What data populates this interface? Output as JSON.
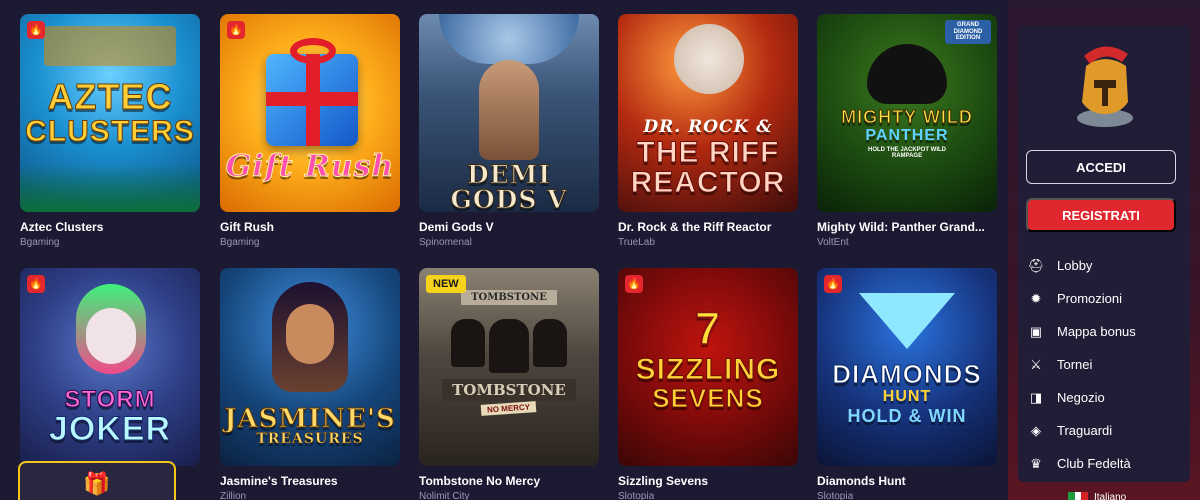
{
  "games": [
    {
      "title": "Aztec Clusters",
      "provider": "Bgaming",
      "badge": "hot",
      "art": {
        "line1": "AZTEC",
        "line2": "CLUSTERS"
      }
    },
    {
      "title": "Gift Rush",
      "provider": "Bgaming",
      "badge": "hot",
      "art": {
        "line1": "Gift Rush"
      }
    },
    {
      "title": "Demi Gods V",
      "provider": "Spinomenal",
      "badge": "",
      "art": {
        "line1": "DEMI GODS V"
      }
    },
    {
      "title": "Dr. Rock & the Riff Reactor",
      "provider": "TrueLab",
      "badge": "",
      "art": {
        "line1": "DR. ROCK &",
        "line2": "THE RIFF",
        "line3": "REACTOR"
      }
    },
    {
      "title": "Mighty Wild: Panther Grand...",
      "provider": "VoltEnt",
      "badge": "",
      "art": {
        "line1": "MIGHTY WILD",
        "line2": "PANTHER",
        "line3": "HOLD THE JACKPOT WILD RAMPAGE",
        "corner": "GRAND DIAMOND EDITION"
      }
    },
    {
      "title": "",
      "provider": "",
      "badge": "hot",
      "art": {
        "line1": "STORM",
        "line2": "JOKER"
      }
    },
    {
      "title": "Jasmine's Treasures",
      "provider": "Zillion",
      "badge": "",
      "art": {
        "line1": "JASMINE'S",
        "line2": "TREASURES"
      }
    },
    {
      "title": "Tombstone No Mercy",
      "provider": "Nolimit City",
      "badge": "new",
      "art": {
        "line1": "TOMBSTONE",
        "line2": "TOMBSTONE",
        "line3": "NO MERCY"
      }
    },
    {
      "title": "Sizzling Sevens",
      "provider": "Slotopia",
      "badge": "hot",
      "art": {
        "line1": "7",
        "line2": "SIZZLING",
        "line3": "SEVENS"
      }
    },
    {
      "title": "Diamonds Hunt",
      "provider": "Slotopia",
      "badge": "hot",
      "art": {
        "line1": "DIAMONDS",
        "line2": "HUNT",
        "line3": "HOLD & WIN"
      }
    }
  ],
  "badges": {
    "new_label": "NEW"
  },
  "sidebar": {
    "login_label": "ACCEDI",
    "register_label": "REGISTRATI",
    "menu": [
      {
        "label": "Lobby",
        "icon": "helmet-icon",
        "glyph": "⛑"
      },
      {
        "label": "Promozioni",
        "icon": "promo-icon",
        "glyph": "✹"
      },
      {
        "label": "Mappa bonus",
        "icon": "chest-icon",
        "glyph": "▣"
      },
      {
        "label": "Tornei",
        "icon": "swords-icon",
        "glyph": "⚔"
      },
      {
        "label": "Negozio",
        "icon": "wallet-icon",
        "glyph": "◨"
      },
      {
        "label": "Traguardi",
        "icon": "ticket-icon",
        "glyph": "◈"
      },
      {
        "label": "Club Fedeltà",
        "icon": "crown-icon",
        "glyph": "♛"
      }
    ],
    "language": "Italiano"
  },
  "gift_icon": "🎁",
  "colors": {
    "background": "#1c1a33",
    "accent_red": "#e0262e",
    "hot_badge": "#e4262d",
    "new_badge": "#f5d21b",
    "gift_border": "#f5c518"
  }
}
